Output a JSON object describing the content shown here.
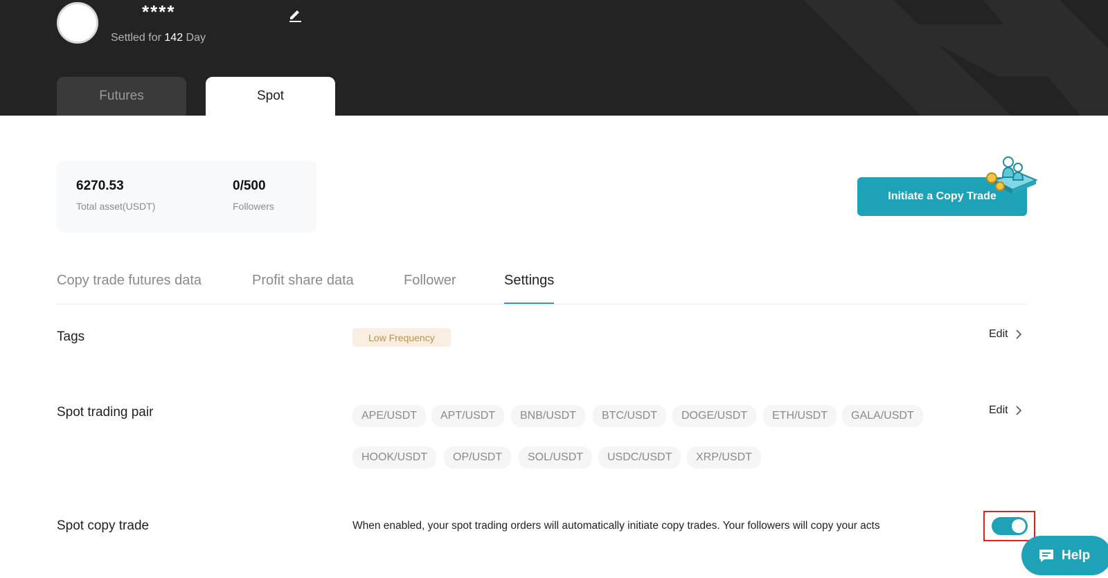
{
  "header": {
    "nickname": "****",
    "settled_prefix": "Settled for",
    "settled_days": "142",
    "settled_suffix": "Day"
  },
  "main_tabs": [
    {
      "label": "Futures",
      "active": false
    },
    {
      "label": "Spot",
      "active": true
    }
  ],
  "stats": {
    "total_asset_value": "6270.53",
    "total_asset_label": "Total asset(USDT)",
    "followers_value": "0/500",
    "followers_label": "Followers"
  },
  "initiate_button": {
    "label": "Initiate a Copy Trade"
  },
  "sub_tabs": [
    {
      "label": "Copy trade futures data",
      "active": false
    },
    {
      "label": "Profit share data",
      "active": false
    },
    {
      "label": "Follower",
      "active": false
    },
    {
      "label": "Settings",
      "active": true
    }
  ],
  "settings": {
    "tags": {
      "title": "Tags",
      "tag": "Low Frequency",
      "edit_label": "Edit"
    },
    "spot_trading_pair": {
      "title": "Spot trading pair",
      "edit_label": "Edit",
      "pairs": [
        "APE/USDT",
        "APT/USDT",
        "BNB/USDT",
        "BTC/USDT",
        "DOGE/USDT",
        "ETH/USDT",
        "GALA/USDT",
        "HOOK/USDT",
        "OP/USDT",
        "SOL/USDT",
        "USDC/USDT",
        "XRP/USDT"
      ]
    },
    "spot_copy_trade": {
      "title": "Spot copy trade",
      "description": "When enabled, your spot trading orders will automatically initiate copy trades. Your followers will copy your acts",
      "enabled": true
    }
  },
  "help": {
    "label": "Help"
  },
  "colors": {
    "accent": "#1ea2b7",
    "header_bg": "#232323",
    "tag_bg": "#f8efe2",
    "tag_text": "#b8904c",
    "highlight_border": "#e02020"
  }
}
